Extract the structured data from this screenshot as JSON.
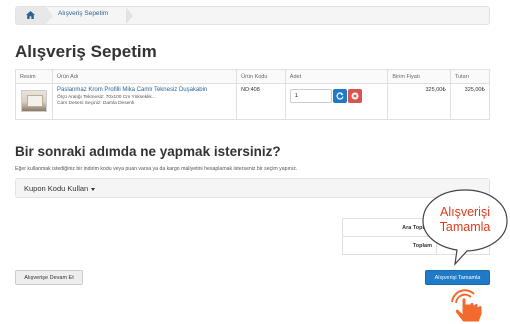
{
  "breadcrumb": {
    "home_icon": "home-icon",
    "current": "Alışveriş Sepetim"
  },
  "page_title": "Alışveriş Sepetim",
  "cart": {
    "headers": [
      "Resim",
      "Ürün Adı",
      "Ürün Kodu",
      "Adet",
      "Birim Fiyatı",
      "Tutarı"
    ],
    "items": [
      {
        "name": "Paslanmaz Krom Profilli Mika Camlı Teknesiz Duşakabin",
        "options": [
          "Ölçü Aralığı Tekmesiz: 70x100 Cm Yükseklik...",
          "Cam Deseni Seçiniz: Damla Desenli"
        ],
        "code": "ND:408",
        "quantity": "1",
        "unit_price": "325,00₺",
        "total": "325,00₺"
      }
    ]
  },
  "next_step": {
    "title": "Bir sonraki adımda ne yapmak istersiniz?",
    "description": "Eğer kullanmak istediğiniz bir indirim kodu veya puan varsa ya da kargo maliyetini hesaplamak isterseniz bir seçim yapınız."
  },
  "coupon": {
    "label": "Kupon Kodu Kullan"
  },
  "totals": {
    "subtotal_label": "Ara Toplam",
    "total_label": "Toplam"
  },
  "buttons": {
    "continue": "Alışverişe Devam Et",
    "checkout": "Alışverişi Tamamla"
  },
  "callout": {
    "line1": "Alışverişi",
    "line2": "Tamamla"
  },
  "colors": {
    "primary": "#1f7ac7",
    "danger": "#d9534f",
    "callout_text": "#e03a1e",
    "cursor": "#f26a2e"
  }
}
